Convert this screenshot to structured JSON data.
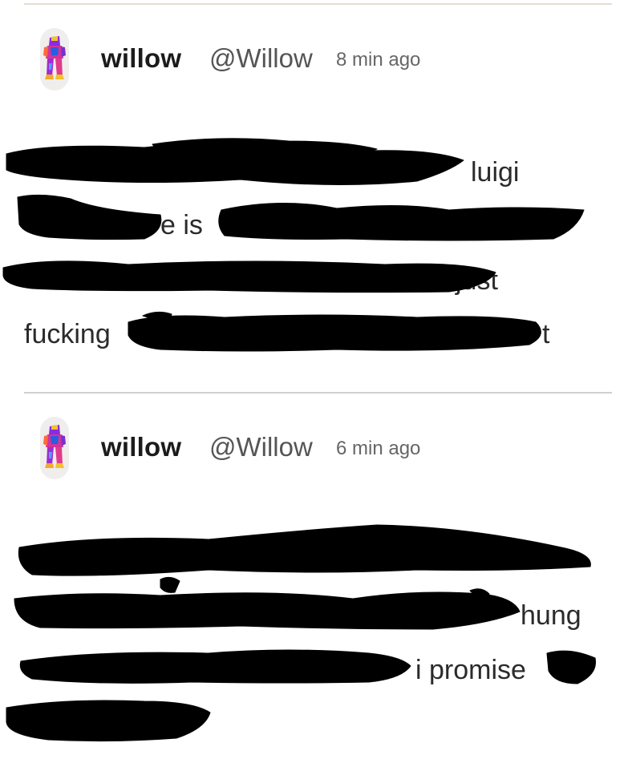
{
  "posts": [
    {
      "author": "willow",
      "handle": "@Willow",
      "timestamp": "8 min ago",
      "visible_text": {
        "line1_tail": "luigi",
        "line2_mid": "e is",
        "line3_tail": "just",
        "line4_head": "fucking",
        "line4_tail": "t"
      }
    },
    {
      "author": "willow",
      "handle": "@Willow",
      "timestamp": "6 min ago",
      "visible_text": {
        "line2_tail": "hung",
        "line3_tail": "i promise"
      }
    }
  ],
  "colors": {
    "text": "#2b2b2b",
    "handle": "#555555",
    "timestamp": "#666666",
    "divider": "#cfcfcf",
    "redaction": "#000000"
  },
  "icons": {
    "avatar": "robot-figure-avatar"
  }
}
